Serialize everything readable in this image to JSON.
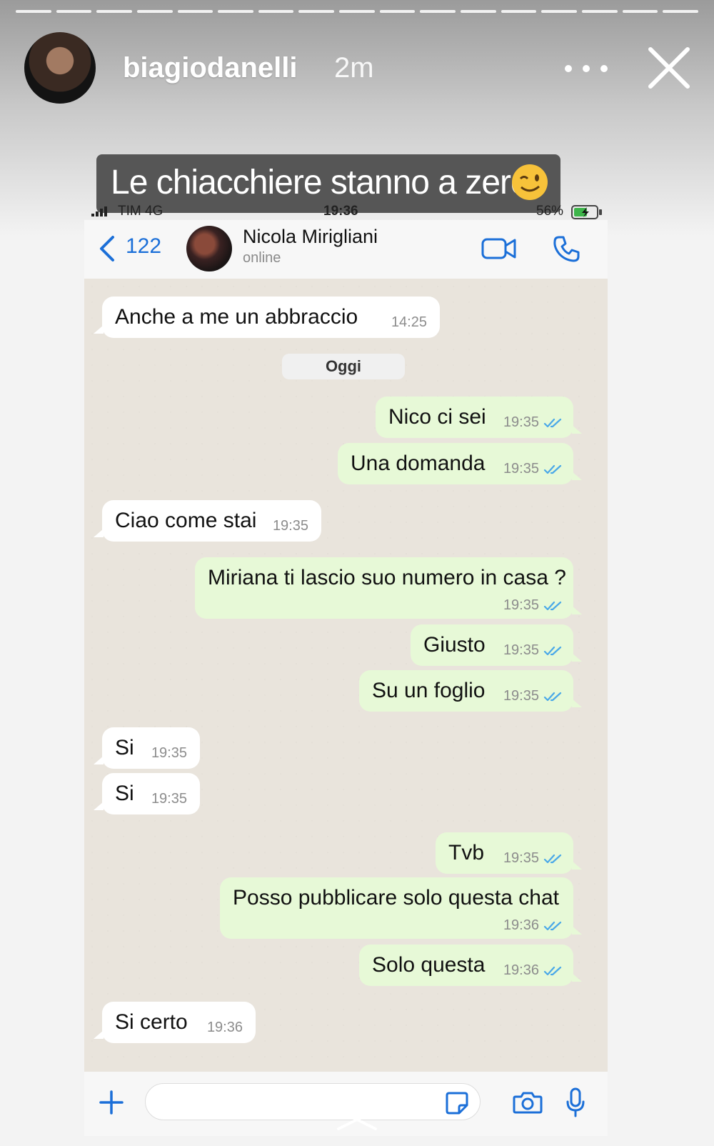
{
  "story": {
    "username": "biagiodanelli",
    "time_ago": "2m",
    "caption": "Le chiacchiere stanno a zero",
    "progress_segments": 17,
    "icons": [
      "more-icon",
      "close-icon",
      "wink-emoji-icon"
    ]
  },
  "phone_status": {
    "carrier": "TIM  4G",
    "time": "19:36",
    "battery": "56%"
  },
  "chat_header": {
    "back_count": "122",
    "contact_name": "Nicola Mirigliani",
    "contact_status": "online",
    "icons": [
      "back-icon",
      "video-call-icon",
      "phone-call-icon"
    ]
  },
  "chat": {
    "day_label": "Oggi",
    "messages": [
      {
        "dir": "in",
        "text": "Anche a me un abbraccio",
        "time": "14:25"
      },
      {
        "dir": "out",
        "text": "Nico ci sei",
        "time": "19:35"
      },
      {
        "dir": "out",
        "text": "Una domanda",
        "time": "19:35"
      },
      {
        "dir": "in",
        "text": "Ciao come stai",
        "time": "19:35"
      },
      {
        "dir": "out",
        "text": "Miriana ti lascio suo numero in casa ?",
        "time": "19:35"
      },
      {
        "dir": "out",
        "text": "Giusto",
        "time": "19:35"
      },
      {
        "dir": "out",
        "text": "Su un foglio",
        "time": "19:35"
      },
      {
        "dir": "in",
        "text": "Si",
        "time": "19:35"
      },
      {
        "dir": "in",
        "text": "Si",
        "time": "19:35"
      },
      {
        "dir": "out",
        "text": "Tvb",
        "time": "19:35"
      },
      {
        "dir": "out",
        "text": "Posso pubblicare solo questa chat",
        "time": "19:36"
      },
      {
        "dir": "out",
        "text": "Solo questa",
        "time": "19:36"
      },
      {
        "dir": "in",
        "text": "Si certo",
        "time": "19:36"
      }
    ]
  },
  "input_bar": {
    "placeholder": "",
    "icons": [
      "plus-icon",
      "sticker-icon",
      "camera-icon",
      "mic-icon"
    ]
  },
  "colors": {
    "outgoing_bubble": "#e7f9d7",
    "incoming_bubble": "#ffffff",
    "accent_blue": "#1b6fd8",
    "read_tick": "#4aa8e8"
  }
}
